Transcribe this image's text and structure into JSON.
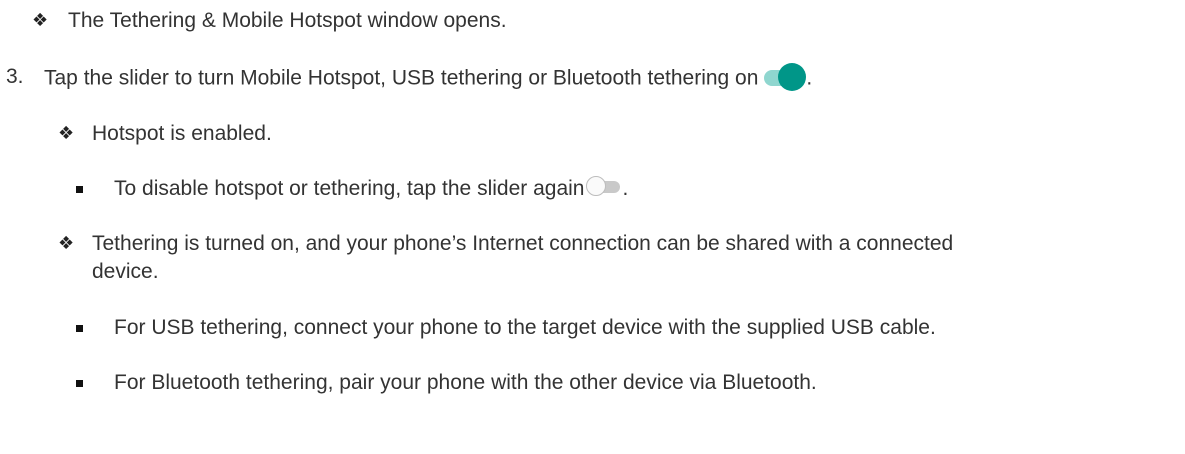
{
  "steps": {
    "intro_result": {
      "bullet": "❖",
      "text": "The Tethering & Mobile Hotspot window opens."
    },
    "step3": {
      "number": "3.",
      "text": "Tap the slider to turn Mobile Hotspot, USB tethering or Bluetooth tethering on",
      "suffix": ".",
      "toggle_state": "on"
    },
    "result_hotspot": {
      "bullet": "❖",
      "text": "Hotspot is enabled."
    },
    "disable_note": {
      "text": "To disable hotspot or tethering, tap the slider again",
      "suffix": ".",
      "toggle_state": "off"
    },
    "result_tethering": {
      "bullet": "❖",
      "text_line1": "Tethering is turned on, and your phone’s Internet connection can be shared with a connected",
      "text_line2": "device."
    },
    "usb_note": {
      "text": "For USB tethering, connect your phone to the target device with the supplied USB cable."
    },
    "bt_note": {
      "text": "For Bluetooth tethering, pair your phone with the other device via Bluetooth."
    }
  },
  "colors": {
    "toggle_on_track": "#8fd6cf",
    "toggle_on_thumb": "#009688",
    "toggle_off_track": "#c9c9c9",
    "toggle_off_thumb": "#fafafa",
    "text": "#333333"
  },
  "icons": {
    "diamond_bullet": "four-diamond-bullet-icon",
    "square_bullet": "square-bullet-icon",
    "toggle_on": "toggle-on-icon",
    "toggle_off": "toggle-off-icon"
  }
}
